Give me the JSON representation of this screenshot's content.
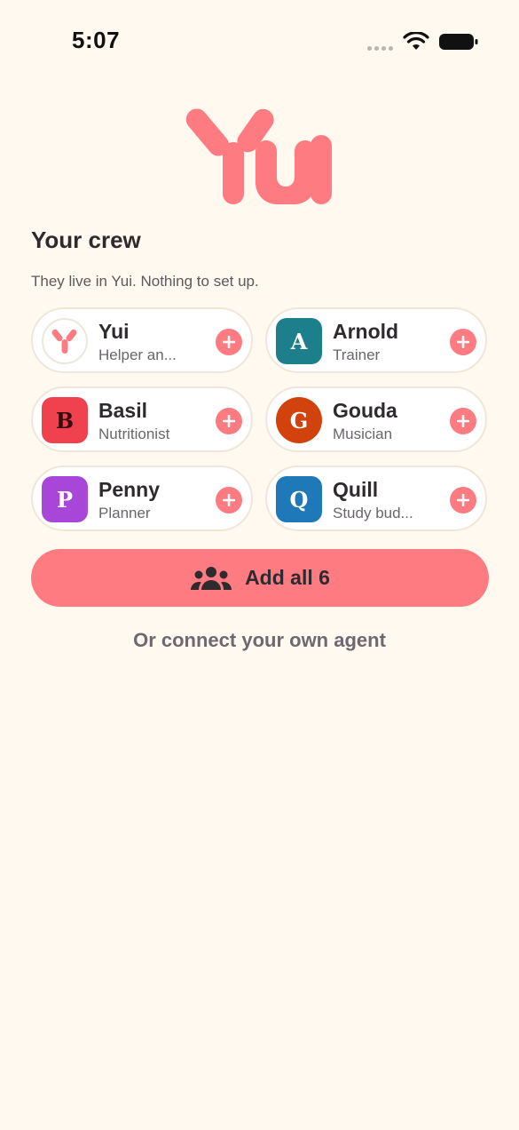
{
  "status_bar": {
    "time": "5:07",
    "icons": [
      "cellular-icon",
      "wifi-icon",
      "battery-icon"
    ]
  },
  "logo": {
    "text": "Yui",
    "color": "#FF7B82"
  },
  "crew": {
    "title": "Your crew",
    "subtitle": "They live in Yui. Nothing to set up.",
    "agents": [
      {
        "name": "Yui",
        "role": "Helper an...",
        "avatar_letter": "",
        "avatar_color": "#FFFFFF",
        "avatar_icon": "yui-logo-icon"
      },
      {
        "name": "Arnold",
        "role": "Trainer",
        "avatar_letter": "A",
        "avatar_color": "#1E7F8C"
      },
      {
        "name": "Basil",
        "role": "Nutritionist",
        "avatar_letter": "B",
        "avatar_color": "#F0414F"
      },
      {
        "name": "Gouda",
        "role": "Musician",
        "avatar_letter": "G",
        "avatar_color": "#D2420C"
      },
      {
        "name": "Penny",
        "role": "Planner",
        "avatar_letter": "P",
        "avatar_color": "#A746D8"
      },
      {
        "name": "Quill",
        "role": "Study bud...",
        "avatar_letter": "Q",
        "avatar_color": "#1F78B8"
      }
    ]
  },
  "actions": {
    "add_all_label": "Add all 6",
    "add_all_icon": "people-group-icon",
    "connect_label": "Or connect your own agent"
  },
  "colors": {
    "accent": "#FF7B82",
    "background": "#FFF9EF"
  }
}
